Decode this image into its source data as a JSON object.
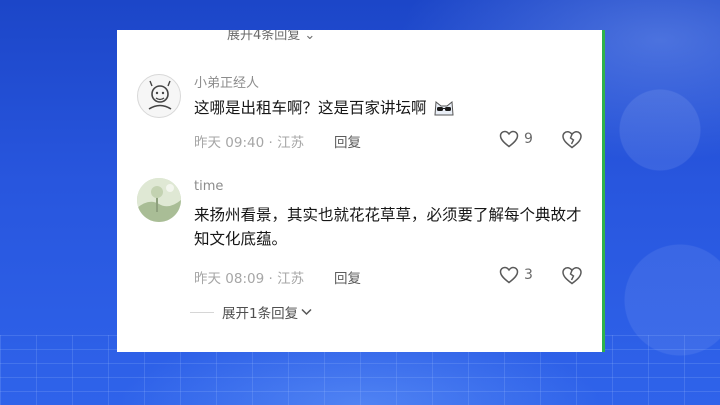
{
  "collapsed_replies_top": "展开4条回复",
  "comments": [
    {
      "username": "小弟正经人",
      "text": "这哪是出租车啊？这是百家讲坛啊",
      "time": "昨天 09:40",
      "location": "江苏",
      "reply_label": "回复",
      "likes": "9",
      "avatar_icon": "doodle-avatar",
      "emoji_icon": "cat-sunglasses-emoji"
    },
    {
      "username": "time",
      "text": "来扬州看景，其实也就花花草草，必须要了解每个典故才知文化底蕴。",
      "time": "昨天 08:09",
      "location": "江苏",
      "reply_label": "回复",
      "likes": "3",
      "avatar_icon": "landscape-photo-avatar"
    }
  ],
  "expand_replies": "展开1条回复",
  "colors": {
    "background_blue": "#2856de",
    "panel_white": "#ffffff",
    "edge_green": "#2fb24c"
  }
}
